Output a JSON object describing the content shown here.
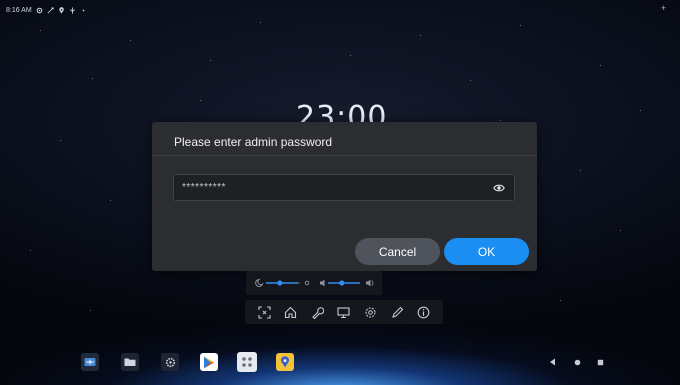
{
  "status_bar": {
    "time": "8:16 AM",
    "icons": [
      "settings-icon",
      "link-icon",
      "location-icon",
      "tree-icon",
      "dot-icon"
    ],
    "corner_icon": "plus-icon"
  },
  "clock": {
    "text": "23:00"
  },
  "dialog": {
    "title": "Please enter admin password",
    "password_value": "**********",
    "cancel_label": "Cancel",
    "ok_label": "OK",
    "accent_color": "#1b8ef2"
  },
  "sliders": {
    "brightness_icon": "moon-icon",
    "brightness_level": 0.3,
    "volume_icon": "speaker-icon",
    "volume_level": 0.3
  },
  "toolbar": {
    "tools": [
      "screenshot-icon",
      "home-icon",
      "wrench-icon",
      "screen-share-icon",
      "gear-icon",
      "pen-icon",
      "info-icon"
    ]
  },
  "dock": {
    "apps": [
      "app-icon-1",
      "folder-app-icon",
      "settings-app-icon",
      "play-store-icon",
      "app-drawer-icon",
      "maps-icon"
    ]
  },
  "navigation": [
    "back-icon",
    "home-dot-icon",
    "recents-icon"
  ]
}
